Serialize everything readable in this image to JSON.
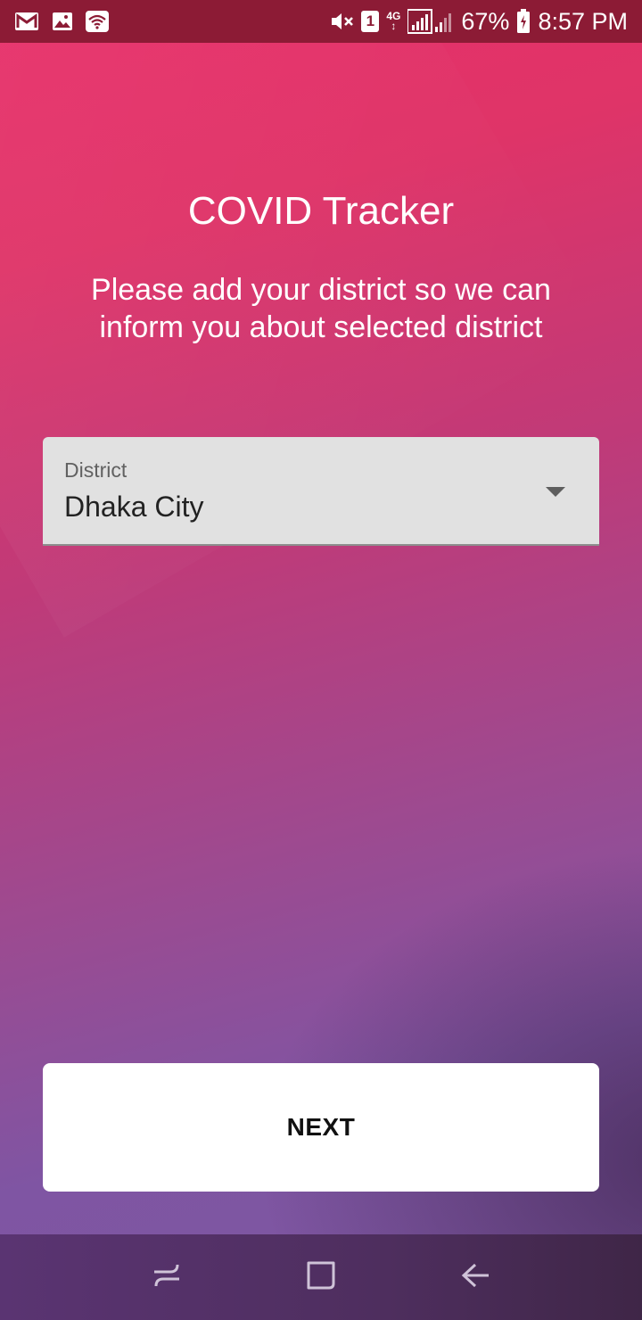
{
  "status_bar": {
    "icons_left": [
      "gmail-icon",
      "gallery-icon",
      "wifi-icon"
    ],
    "icons_right": [
      "mute-vibrate-icon",
      "sim-icon",
      "network-4g-icon",
      "signal-icon",
      "battery-icon"
    ],
    "sim_number": "1",
    "network_type": "4G",
    "battery_percent": "67%",
    "time": "8:57 PM"
  },
  "main": {
    "title": "COVID Tracker",
    "subtitle": "Please add your district so we can inform you about selected district"
  },
  "district_select": {
    "label": "District",
    "selected_value": "Dhaka City"
  },
  "next_button": {
    "label": "NEXT"
  },
  "nav_bar": {
    "items": [
      "recent-apps-icon",
      "home-icon",
      "back-icon"
    ]
  },
  "colors": {
    "status_bar_bg": "#8c1b35",
    "gradient_top": "#e8306a",
    "gradient_bottom": "#7d57a0",
    "dropdown_bg": "#e1e1e1",
    "button_bg": "#ffffff"
  }
}
